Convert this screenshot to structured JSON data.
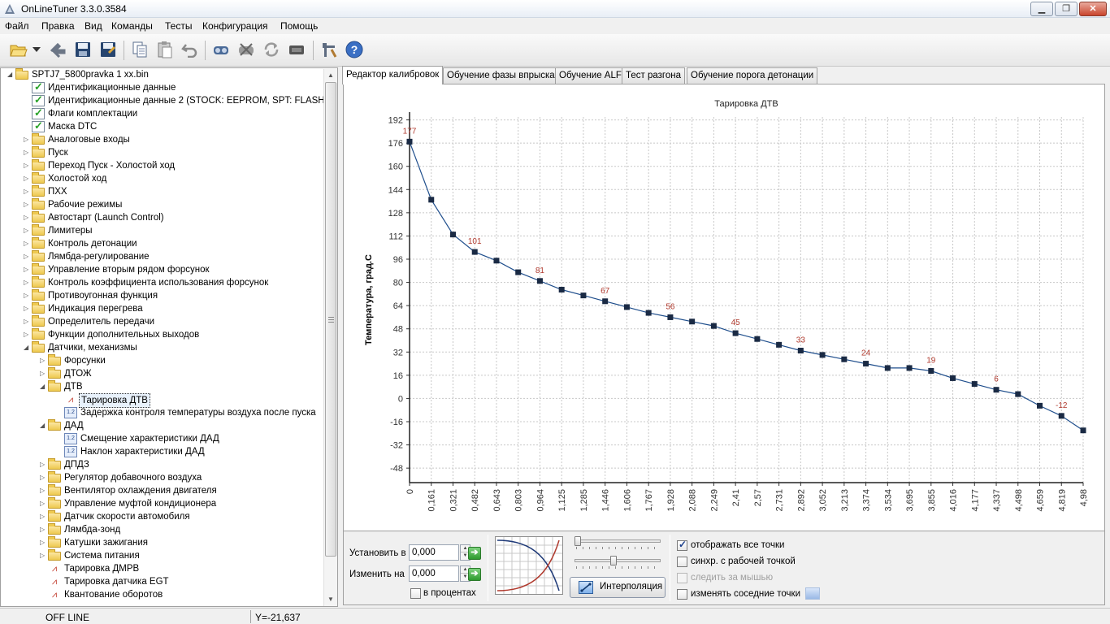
{
  "window": {
    "title": "OnLineTuner 3.3.0.3584"
  },
  "menu": [
    "Файл",
    "Правка",
    "Вид",
    "Команды",
    "Тесты",
    "Конфигурация",
    "Помощь"
  ],
  "toolbar_icons": [
    "open-folder-icon",
    "dropdown-arrow-icon",
    "reload-icon",
    "save-icon",
    "save-as-icon",
    "copy-icon",
    "paste-icon",
    "undo-icon",
    "connect-icon",
    "disconnect-icon",
    "refresh-icon",
    "ecu-icon",
    "tools-icon",
    "help-icon"
  ],
  "tree": {
    "root": "SPTJ7_5800pravka 1 xx.bin",
    "nodes": [
      {
        "label": "Идентификационные данные",
        "level": 1,
        "icon": "checked-doc-icon",
        "expander": ""
      },
      {
        "label": "Идентификационные данные 2 (STOCK: EEPROM, SPT: FLASH)",
        "level": 1,
        "icon": "checked-doc-icon",
        "expander": ""
      },
      {
        "label": "Флаги комплектации",
        "level": 1,
        "icon": "checked-doc-icon",
        "expander": ""
      },
      {
        "label": "Маска DTC",
        "level": 1,
        "icon": "checked-doc-icon",
        "expander": ""
      },
      {
        "label": "Аналоговые входы",
        "level": 1,
        "icon": "folder-icon",
        "expander": "▷"
      },
      {
        "label": "Пуск",
        "level": 1,
        "icon": "folder-icon",
        "expander": "▷"
      },
      {
        "label": "Переход Пуск - Холостой ход",
        "level": 1,
        "icon": "folder-icon",
        "expander": "▷"
      },
      {
        "label": "Холостой ход",
        "level": 1,
        "icon": "folder-icon",
        "expander": "▷"
      },
      {
        "label": "ПХХ",
        "level": 1,
        "icon": "folder-icon",
        "expander": "▷"
      },
      {
        "label": "Рабочие режимы",
        "level": 1,
        "icon": "folder-icon",
        "expander": "▷"
      },
      {
        "label": "Автостарт (Launch Control)",
        "level": 1,
        "icon": "folder-icon",
        "expander": "▷"
      },
      {
        "label": "Лимитеры",
        "level": 1,
        "icon": "folder-icon",
        "expander": "▷"
      },
      {
        "label": "Контроль детонации",
        "level": 1,
        "icon": "folder-icon",
        "expander": "▷"
      },
      {
        "label": "Лямбда-регулирование",
        "level": 1,
        "icon": "folder-icon",
        "expander": "▷"
      },
      {
        "label": "Управление вторым рядом форсунок",
        "level": 1,
        "icon": "folder-icon",
        "expander": "▷"
      },
      {
        "label": "Контроль коэффициента использования форсунок",
        "level": 1,
        "icon": "folder-icon",
        "expander": "▷"
      },
      {
        "label": "Противоугонная функция",
        "level": 1,
        "icon": "folder-icon",
        "expander": "▷"
      },
      {
        "label": "Индикация перегрева",
        "level": 1,
        "icon": "folder-icon",
        "expander": "▷"
      },
      {
        "label": "Определитель передачи",
        "level": 1,
        "icon": "folder-icon",
        "expander": "▷"
      },
      {
        "label": "Функции дополнительных выходов",
        "level": 1,
        "icon": "folder-icon",
        "expander": "▷"
      },
      {
        "label": "Датчики, механизмы",
        "level": 1,
        "icon": "folder-icon",
        "expander": "◢"
      },
      {
        "label": "Форсунки",
        "level": 2,
        "icon": "folder-icon",
        "expander": "▷"
      },
      {
        "label": "ДТОЖ",
        "level": 2,
        "icon": "folder-icon",
        "expander": "▷"
      },
      {
        "label": "ДТВ",
        "level": 2,
        "icon": "folder-icon",
        "expander": "◢"
      },
      {
        "label": "Тарировка ДТВ",
        "level": 3,
        "icon": "map-icon",
        "expander": "",
        "selected": true
      },
      {
        "label": "Задержка контроля температуры воздуха после пуска",
        "level": 3,
        "icon": "scalar-icon",
        "expander": ""
      },
      {
        "label": "ДАД",
        "level": 2,
        "icon": "folder-icon",
        "expander": "◢"
      },
      {
        "label": "Смещение характеристики ДАД",
        "level": 3,
        "icon": "scalar-icon",
        "expander": ""
      },
      {
        "label": "Наклон характеристики ДАД",
        "level": 3,
        "icon": "scalar-icon",
        "expander": ""
      },
      {
        "label": "ДПДЗ",
        "level": 2,
        "icon": "folder-icon",
        "expander": "▷"
      },
      {
        "label": "Регулятор добавочного воздуха",
        "level": 2,
        "icon": "folder-icon",
        "expander": "▷"
      },
      {
        "label": "Вентилятор охлаждения двигателя",
        "level": 2,
        "icon": "folder-icon",
        "expander": "▷"
      },
      {
        "label": "Управление муфтой кондиционера",
        "level": 2,
        "icon": "folder-icon",
        "expander": "▷"
      },
      {
        "label": "Датчик скорости автомобиля",
        "level": 2,
        "icon": "folder-icon",
        "expander": "▷"
      },
      {
        "label": "Лямбда-зонд",
        "level": 2,
        "icon": "folder-icon",
        "expander": "▷"
      },
      {
        "label": "Катушки зажигания",
        "level": 2,
        "icon": "folder-icon",
        "expander": "▷"
      },
      {
        "label": "Система питания",
        "level": 2,
        "icon": "folder-icon",
        "expander": "▷"
      },
      {
        "label": "Тарировка ДМРВ",
        "level": 2,
        "icon": "map-icon",
        "expander": ""
      },
      {
        "label": "Тарировка датчика EGT",
        "level": 2,
        "icon": "map-icon",
        "expander": ""
      },
      {
        "label": "Квантование оборотов",
        "level": 2,
        "icon": "map-icon",
        "expander": ""
      }
    ]
  },
  "tabs": [
    "Редактор калибровок",
    "Обучение фазы впрыска",
    "Обучение ALF",
    "Тест разгона",
    "Обучение порога детонации"
  ],
  "chart_data": {
    "type": "line",
    "title": "Тарировка ДТВ",
    "ylabel": "Температура, град.С",
    "xlabel": "",
    "ylim": [
      -58,
      194
    ],
    "yticks": [
      192,
      176,
      160,
      144,
      128,
      112,
      96,
      80,
      64,
      48,
      32,
      16,
      0,
      -16,
      -32,
      -48
    ],
    "xtick_labels": [
      "0",
      "0,161",
      "0,321",
      "0,482",
      "0,643",
      "0,803",
      "0,964",
      "1,125",
      "1,285",
      "1,446",
      "1,606",
      "1,767",
      "1,928",
      "2,088",
      "2,249",
      "2,41",
      "2,57",
      "2,731",
      "2,892",
      "3,052",
      "3,213",
      "3,374",
      "3,534",
      "3,695",
      "3,855",
      "4,016",
      "4,177",
      "4,337",
      "4,498",
      "4,659",
      "4,819",
      "4,98"
    ],
    "grid": true,
    "legend": "none",
    "line_color": "#1f4e8c",
    "marker_color": "#1a2a44",
    "label_color": "#b03a2e",
    "series": [
      {
        "values": [
          177,
          137,
          113,
          101,
          95,
          87,
          81,
          75,
          71,
          67,
          63,
          59,
          56,
          53,
          50,
          45,
          41,
          37,
          33,
          30,
          27,
          24,
          21,
          21,
          19,
          14,
          10,
          6,
          3,
          -5,
          -12,
          -22
        ],
        "labeled_points": [
          0,
          3,
          6,
          9,
          12,
          15,
          18,
          21,
          24,
          27,
          30
        ]
      }
    ]
  },
  "controls": {
    "set_label": "Установить в",
    "set_value": "0,000",
    "change_label": "Изменить на",
    "change_value": "0,000",
    "percent_label": "в процентах",
    "percent_checked": false,
    "interp_label": "Интерполяция",
    "slider1_level": 0.0,
    "slider2_level": 0.45,
    "checkboxes": [
      {
        "label": "отображать все точки",
        "checked": true,
        "disabled": false
      },
      {
        "label": "синхр. с рабочей точкой",
        "checked": false,
        "disabled": false
      },
      {
        "label": "следить за мышью",
        "checked": false,
        "disabled": true
      },
      {
        "label": "изменять соседние точки",
        "checked": false,
        "disabled": false
      }
    ]
  },
  "status": {
    "connection": "OFF LINE",
    "y_readout": "Y=-21,637"
  }
}
